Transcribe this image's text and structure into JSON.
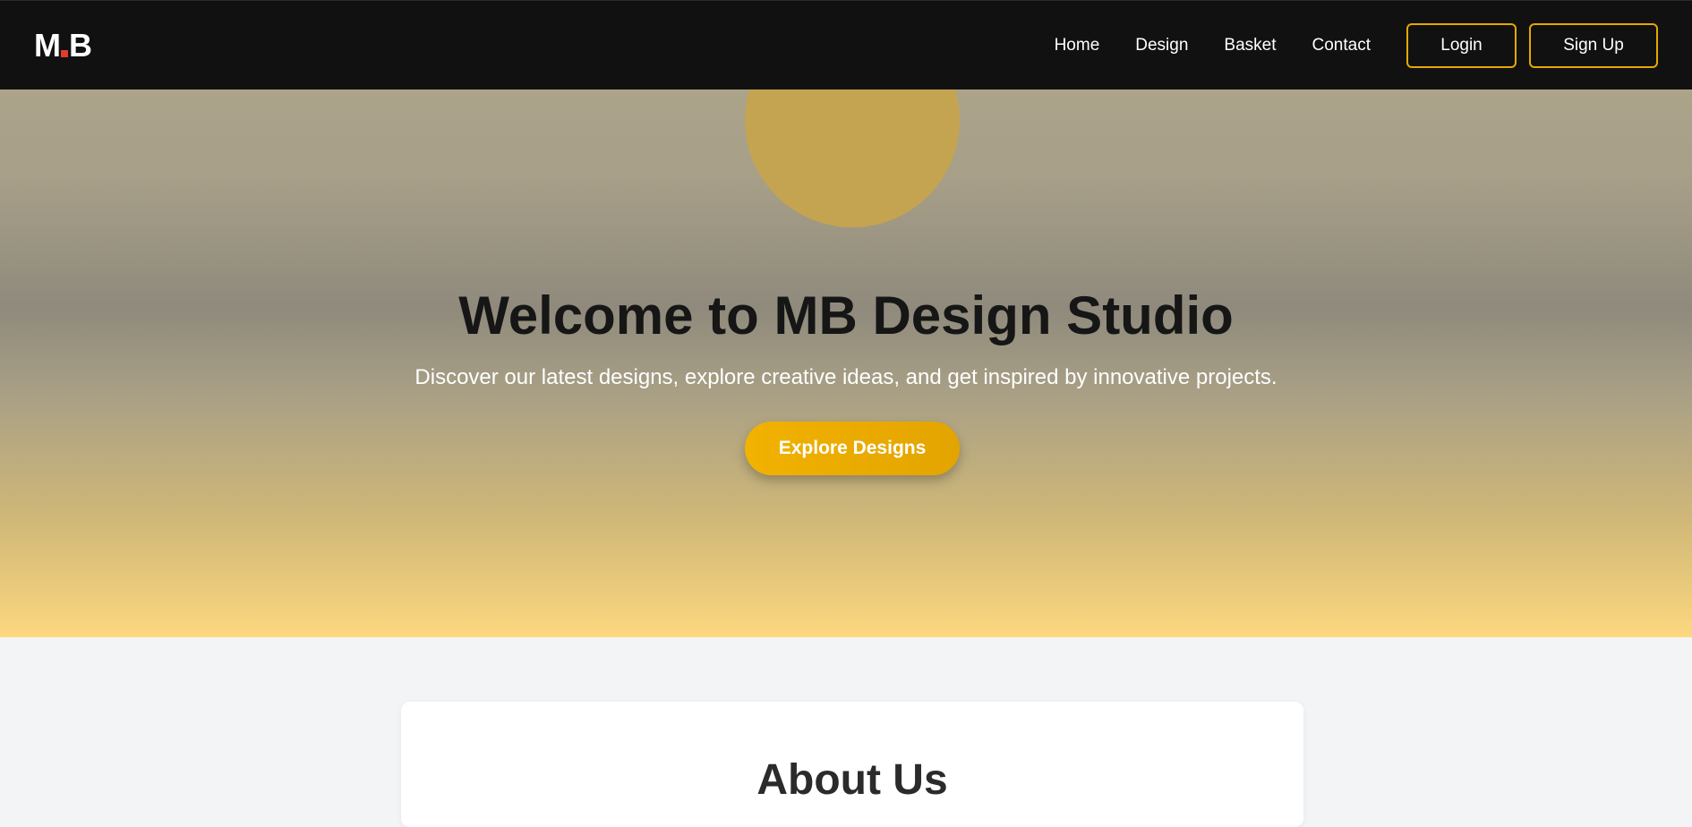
{
  "brand": {
    "logo_left": "M",
    "logo_right": "B",
    "accent_color": "#e6a800",
    "logo_dot_color": "#e23b2f"
  },
  "nav": {
    "links": [
      "Home",
      "Design",
      "Basket",
      "Contact"
    ],
    "login_label": "Login",
    "signup_label": "Sign Up"
  },
  "hero": {
    "title": "Welcome to MB Design Studio",
    "subtitle": "Discover our latest designs, explore creative ideas, and get inspired by innovative projects.",
    "cta_label": "Explore Designs"
  },
  "about": {
    "title": "About Us"
  }
}
